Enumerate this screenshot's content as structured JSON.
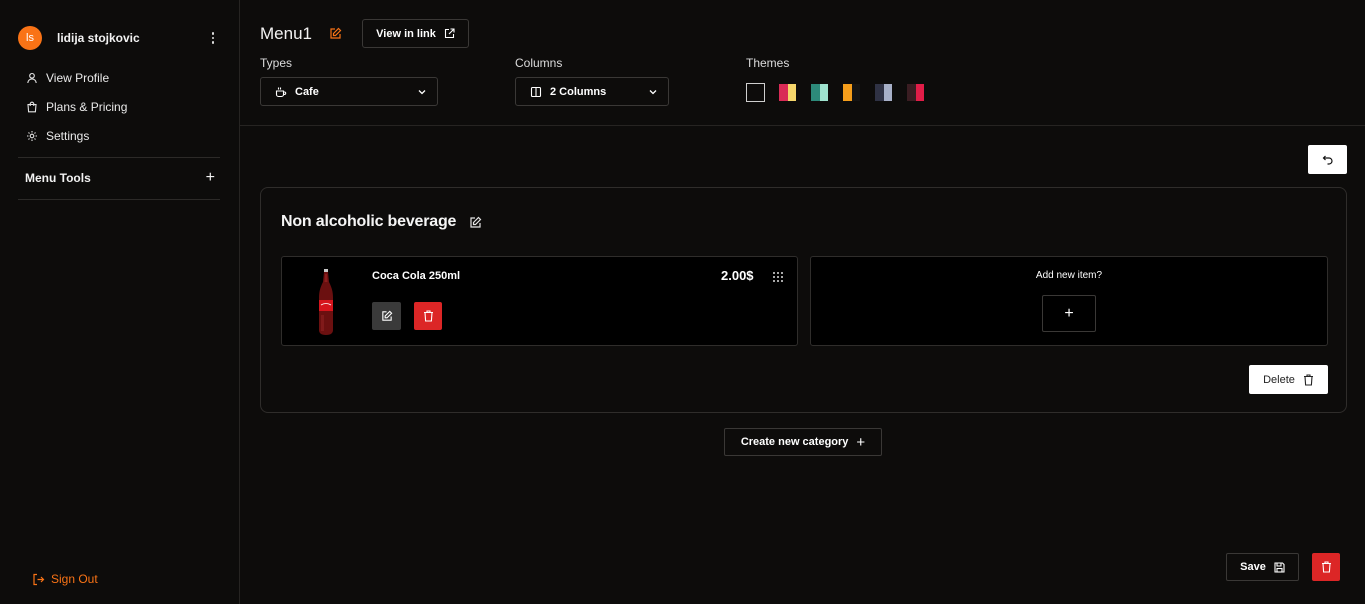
{
  "sidebar": {
    "user": {
      "initials": "ls",
      "name": "lidija stojkovic"
    },
    "items": [
      {
        "label": "View Profile",
        "icon": "user-icon"
      },
      {
        "label": "Plans & Pricing",
        "icon": "shopping-bag-icon"
      },
      {
        "label": "Settings",
        "icon": "gear-icon"
      }
    ],
    "menu_tools": {
      "label": "Menu Tools"
    },
    "sign_out": {
      "label": "Sign Out",
      "icon": "logout-icon"
    }
  },
  "header": {
    "title": "Menu1",
    "view_link_label": "View in link",
    "types": {
      "label": "Types",
      "value": "Cafe",
      "icon": "coffee-cup-icon"
    },
    "columns": {
      "label": "Columns",
      "value": "2 Columns",
      "icon": "columns-icon"
    },
    "themes": {
      "label": "Themes",
      "swatches": [
        {
          "left": "#0d0c0b",
          "right": "#0d0c0b",
          "selected": true
        },
        {
          "left": "#d92b56",
          "right": "#f5d66b",
          "selected": false
        },
        {
          "left": "#2d8a7a",
          "right": "#9fe3cf",
          "selected": false
        },
        {
          "left": "#f59e1b",
          "right": "#141414",
          "selected": false
        },
        {
          "left": "#2f3244",
          "right": "#a7b0c8",
          "selected": false
        },
        {
          "left": "#3a1d22",
          "right": "#e11d48",
          "selected": false
        }
      ]
    }
  },
  "category": {
    "title": "Non alcoholic beverage",
    "items": [
      {
        "name": "Coca Cola 250ml",
        "price": "2.00$",
        "image": "coca-cola-bottle"
      }
    ],
    "add_item_label": "Add new item?",
    "delete_label": "Delete"
  },
  "create_category_label": "Create new category",
  "save_label": "Save",
  "colors": {
    "accent": "#f97316",
    "danger": "#dc2626",
    "background": "#0d0c0b"
  }
}
